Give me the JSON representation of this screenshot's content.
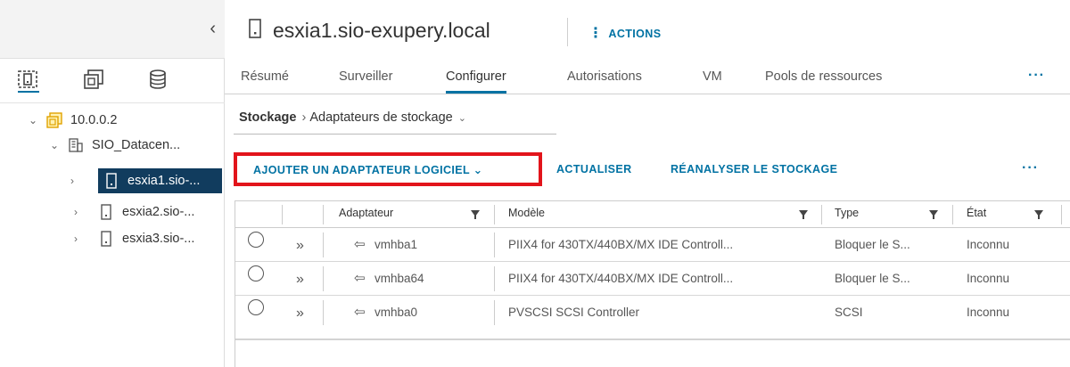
{
  "nav": {
    "collapse_glyph": "‹",
    "view_icons": [
      "hosts-clusters-icon",
      "vms-templates-icon",
      "storage-icon"
    ],
    "tree": [
      {
        "label": "10.0.0.2",
        "toggle": "⌄",
        "icon": "vcenter-icon"
      },
      {
        "label": "SIO_Datacen...",
        "toggle": "⌄",
        "icon": "datacenter-icon"
      },
      {
        "label": "esxia1.sio-...",
        "toggle": "›",
        "icon": "host-icon",
        "selected": true
      },
      {
        "label": "esxia2.sio-...",
        "toggle": "›",
        "icon": "host-icon"
      },
      {
        "label": "esxia3.sio-...",
        "toggle": "›",
        "icon": "host-icon"
      }
    ]
  },
  "header": {
    "title": "esxia1.sio-exupery.local",
    "actions_label": "ACTIONS",
    "actions_glyph": "⋮"
  },
  "tabs": [
    {
      "label": "Résumé"
    },
    {
      "label": "Surveiller"
    },
    {
      "label": "Configurer",
      "active": true
    },
    {
      "label": "Autorisations"
    },
    {
      "label": "VM"
    },
    {
      "label": "Pools de ressources"
    }
  ],
  "tabs_more": "···",
  "breadcrumb": {
    "root": "Stockage",
    "separator": "›",
    "current": "Adaptateurs de stockage",
    "dropdown": "⌄"
  },
  "toolbar": {
    "add_label": "AJOUTER UN ADAPTATEUR LOGICIEL",
    "add_dropdown": "⌄",
    "refresh_label": "ACTUALISER",
    "rescan_label": "RÉANALYSER LE STOCKAGE",
    "more": "···"
  },
  "grid": {
    "columns": [
      "Adaptateur",
      "Modèle",
      "Type",
      "État"
    ],
    "rows": [
      {
        "adapter": "vmhba1",
        "model": "PIIX4 for 430TX/440BX/MX IDE Controll...",
        "type": "Bloquer le S...",
        "status": "Inconnu"
      },
      {
        "adapter": "vmhba64",
        "model": "PIIX4 for 430TX/440BX/MX IDE Controll...",
        "type": "Bloquer le S...",
        "status": "Inconnu"
      },
      {
        "adapter": "vmhba0",
        "model": "PVSCSI SCSI Controller",
        "type": "SCSI",
        "status": "Inconnu"
      }
    ],
    "expand_glyph": "»",
    "adapter_glyph": "⇦"
  },
  "colors": {
    "accent": "#0072a3",
    "selected_row": "#113c5e",
    "highlight_box": "#e2141b",
    "vcenter_icon": "#f5b400"
  }
}
